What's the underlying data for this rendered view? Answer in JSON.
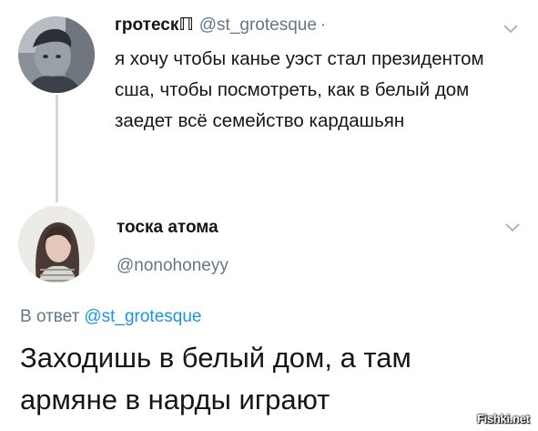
{
  "tweet1": {
    "display_name": "гротескℿ",
    "handle": "@st_grotesque",
    "separator": "·",
    "text": "я хочу чтобы канье уэст стал президентом сша, чтобы посмотреть, как в белый дом заедет всё семейство кардашьян",
    "avatar_icon": "male-portrait-avatar",
    "menu_icon": "chevron-down-icon"
  },
  "tweet2": {
    "display_name": "тоска атома",
    "handle": "@nonohoneyy",
    "reply_prefix": "В ответ",
    "reply_to": "@st_grotesque",
    "text": "Заходишь в белый дом, а там армяне в нарды играют",
    "avatar_icon": "female-portrait-avatar",
    "menu_icon": "chevron-down-icon"
  },
  "watermark": "Fishki.net",
  "colors": {
    "text_primary": "#14171a",
    "text_secondary": "#657786",
    "link": "#1b95e0",
    "thread_line": "#cfd9de"
  }
}
